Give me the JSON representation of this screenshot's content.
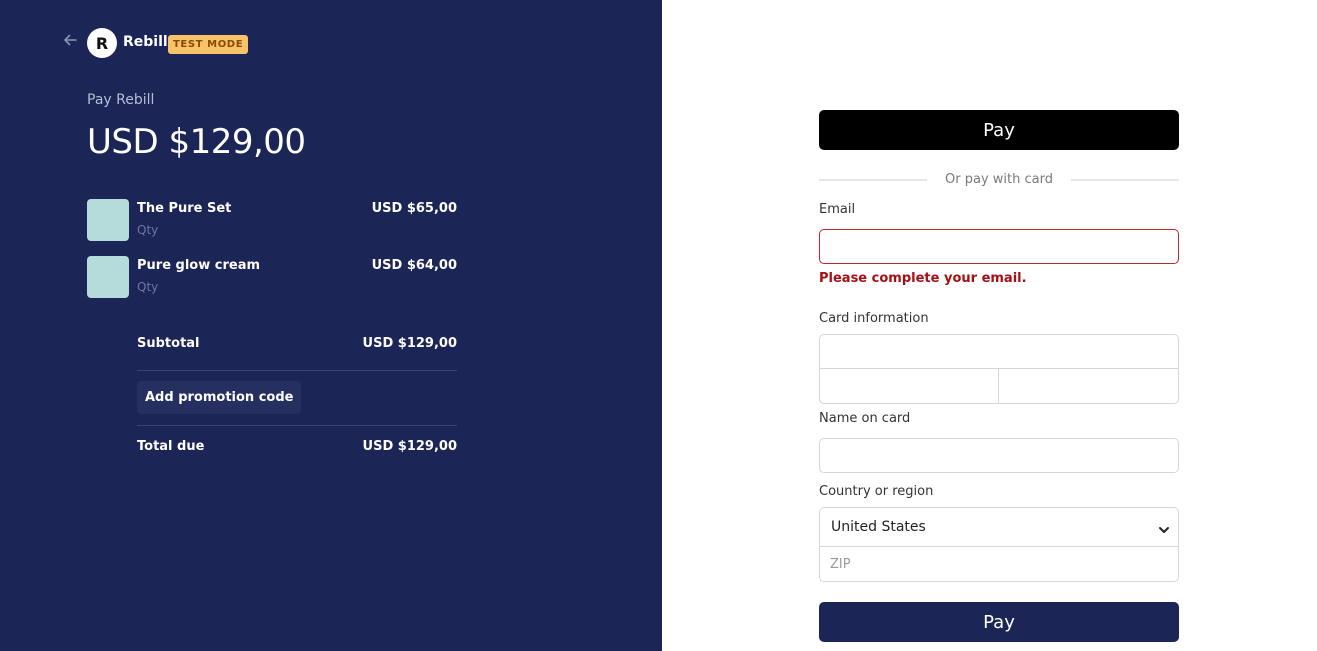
{
  "brand": {
    "logo_letter": "R",
    "name": "Rebill",
    "badge": "TEST MODE"
  },
  "summary": {
    "pay_label": "Pay Rebill",
    "amount": "USD $129,00",
    "items": [
      {
        "name": "The Pure Set",
        "qty_label": "Qty",
        "price": "USD $65,00"
      },
      {
        "name": "Pure glow cream",
        "qty_label": "Qty",
        "price": "USD $64,00"
      }
    ],
    "subtotal_label": "Subtotal",
    "subtotal_value": "USD $129,00",
    "promo_label": "Add promotion code",
    "total_label": "Total due",
    "total_value": "USD $129,00"
  },
  "form": {
    "apple_pay_label": "Pay",
    "or_text": "Or pay with card",
    "email_label": "Email",
    "email_value": "",
    "email_error": "Please complete your email.",
    "card_label": "Card information",
    "name_label": "Name on card",
    "name_value": "",
    "country_label": "Country or region",
    "country_value": "United States",
    "zip_placeholder": "ZIP",
    "pay_label": "Pay"
  },
  "colors": {
    "left_bg": "#1b2556",
    "badge_bg": "#f8c26b",
    "error": "#a80f15",
    "pay_button": "#1b2556",
    "apple_pay_button": "#000000"
  }
}
